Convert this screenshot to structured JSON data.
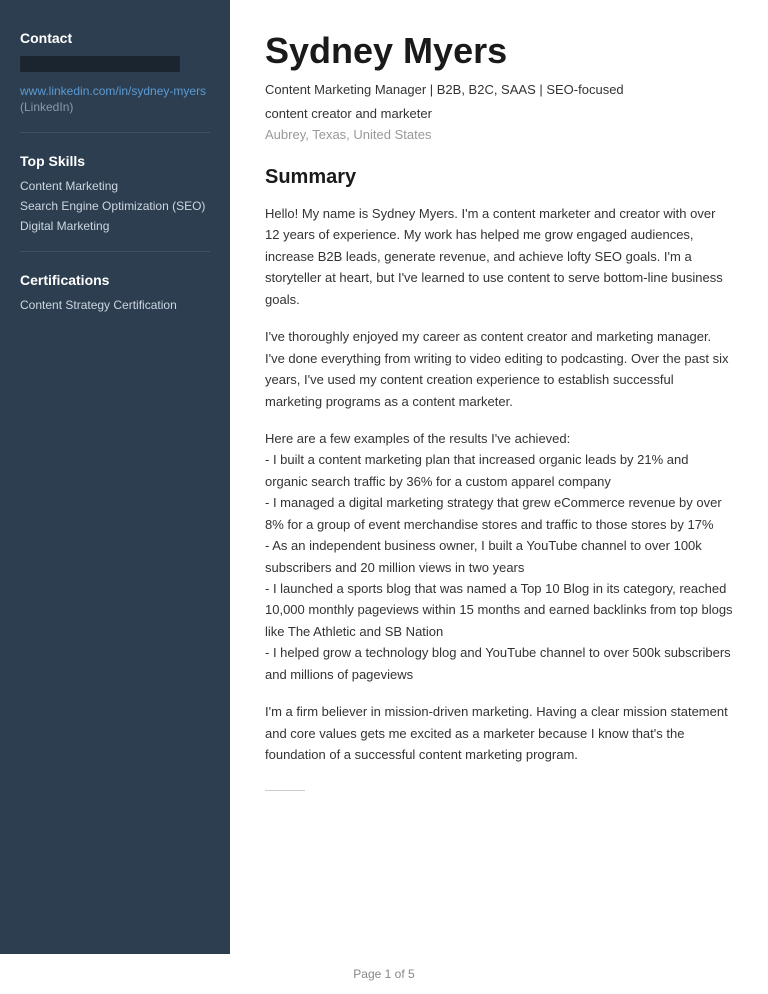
{
  "sidebar": {
    "contact_title": "Contact",
    "redacted_bar": true,
    "linkedin_url": "www.linkedin.com/in/sydney-myers",
    "linkedin_label": "(LinkedIn)",
    "top_skills_title": "Top Skills",
    "skills": [
      "Content Marketing",
      "Search Engine Optimization (SEO)",
      "Digital Marketing"
    ],
    "certifications_title": "Certifications",
    "certifications": [
      "Content Strategy Certification"
    ]
  },
  "profile": {
    "name": "Sydney Myers",
    "headline_line1": "Content Marketing Manager | B2B, B2C, SAAS | SEO-focused",
    "headline_line2": "content creator and marketer",
    "location": "Aubrey, Texas, United States"
  },
  "summary": {
    "section_title": "Summary",
    "paragraph1": "Hello! My name is Sydney Myers. I'm a content marketer and creator with over 12 years of experience. My work has helped me grow engaged audiences, increase B2B leads, generate revenue, and achieve lofty SEO goals. I'm a storyteller at heart, but I've learned to use content to serve bottom-line business goals.",
    "paragraph2": "I've thoroughly enjoyed my career as content creator and marketing manager. I've done everything from writing to video editing to podcasting. Over the past six years, I've used my content creation experience to establish successful marketing programs as a content marketer.",
    "paragraph3": "Here are a few examples of the results I've achieved:\n- I built a content marketing plan that increased organic leads by 21% and organic search traffic by 36% for a custom apparel company\n- I managed a digital marketing strategy that grew eCommerce revenue by over 8% for a group of event merchandise stores and traffic to those stores by 17%\n- As an independent business owner, I built a YouTube channel to over 100k subscribers and 20 million views in two years\n- I launched a sports blog that was named a Top 10 Blog in its category, reached 10,000 monthly pageviews within 15 months and earned backlinks from top blogs like The Athletic and SB Nation\n- I helped grow a technology blog and YouTube channel to over 500k subscribers and millions of pageviews",
    "paragraph4": "I'm a firm believer in mission-driven marketing. Having a clear mission statement and core values gets me excited as a marketer because I know that's the foundation of a successful content marketing program."
  },
  "footer": {
    "page_indicator": "Page 1 of 5"
  }
}
